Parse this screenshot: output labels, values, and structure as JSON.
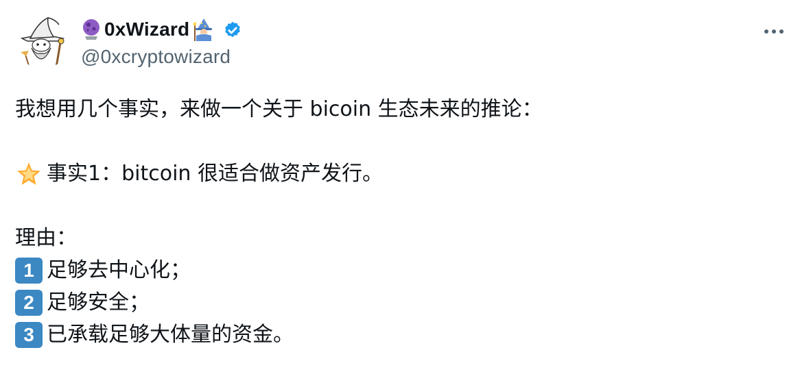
{
  "author": {
    "display_name": "0xWizard",
    "handle": "@0xcryptowizard",
    "verified": true,
    "name_prefix_icon": "crystal-ball-icon",
    "name_suffix_icon": "wizard-icon"
  },
  "menu": {
    "icon": "more-horizontal-icon"
  },
  "content": {
    "intro": "我想用几个事实，来做一个关于 bicoin 生态未来的推论：",
    "fact1_icon": "glowing-star-icon",
    "fact1": "事实1：bitcoin 很适合做资产发行。",
    "reason_heading": "理由：",
    "reasons": [
      {
        "badge": "1",
        "text": "足够去中心化；"
      },
      {
        "badge": "2",
        "text": "足够安全；"
      },
      {
        "badge": "3",
        "text": "已承载足够大体量的资金。"
      }
    ]
  },
  "colors": {
    "text": "#0f1419",
    "secondary": "#536471",
    "verified": "#1d9bf0",
    "keycap": "#3b88c3"
  }
}
